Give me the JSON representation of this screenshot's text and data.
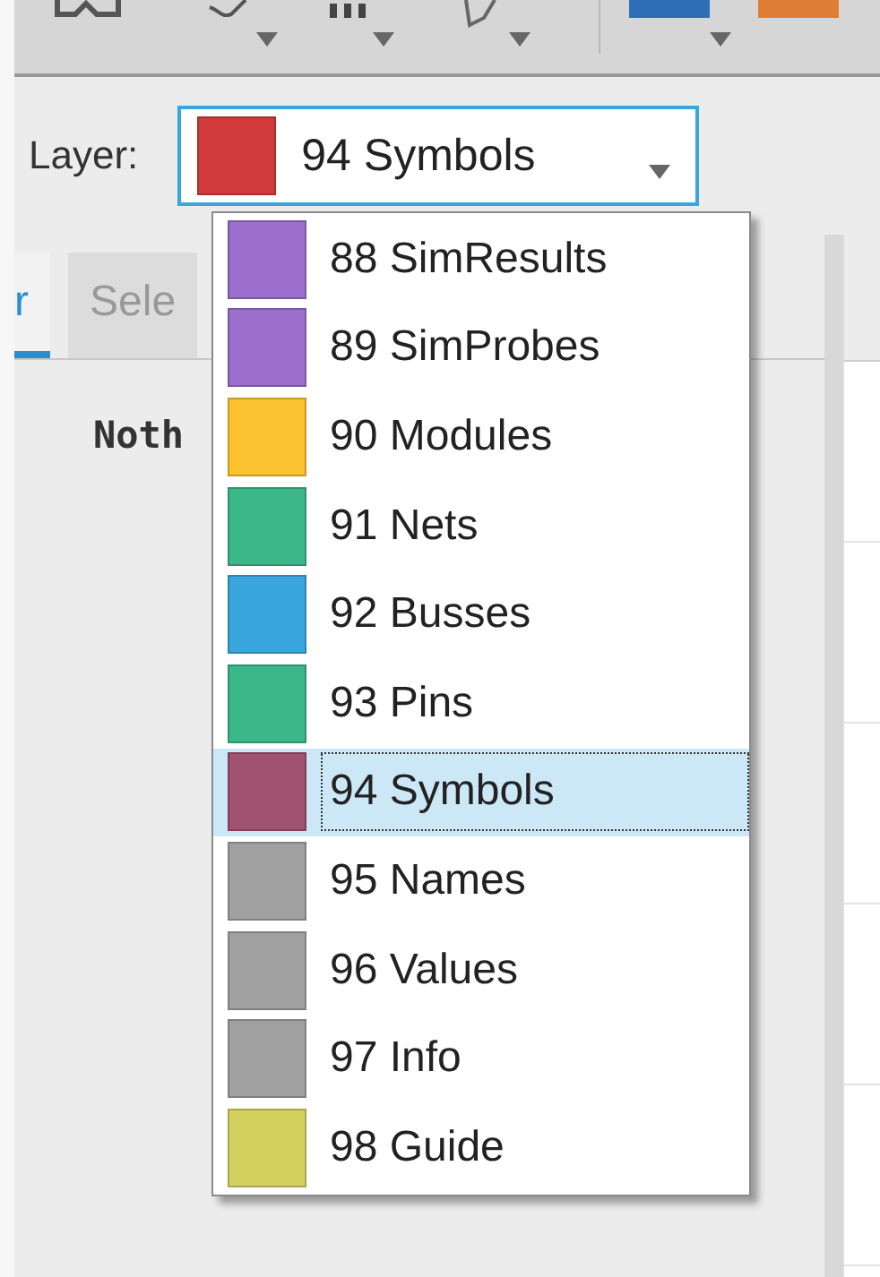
{
  "toolbar": {
    "swatches": [
      {
        "color": "#2d6fb7"
      },
      {
        "color": "#e07d35"
      }
    ]
  },
  "layer": {
    "label": "Layer:",
    "value": "94 Symbols",
    "color": "#d13b3b"
  },
  "layers": [
    {
      "name": "88 SimResults",
      "color": "#9b6fcb",
      "selected": false
    },
    {
      "name": "89 SimProbes",
      "color": "#9b6fcb",
      "selected": false
    },
    {
      "name": "90 Modules",
      "color": "#fbc12f",
      "selected": false
    },
    {
      "name": "91 Nets",
      "color": "#3bb78a",
      "selected": false
    },
    {
      "name": "92 Busses",
      "color": "#3aa6de",
      "selected": false
    },
    {
      "name": "93 Pins",
      "color": "#3bb78a",
      "selected": false
    },
    {
      "name": "94 Symbols",
      "color": "#a0526e",
      "selected": true
    },
    {
      "name": "95 Names",
      "color": "#a0a0a0",
      "selected": false
    },
    {
      "name": "96 Values",
      "color": "#a0a0a0",
      "selected": false
    },
    {
      "name": "97 Info",
      "color": "#a0a0a0",
      "selected": false
    },
    {
      "name": "98 Guide",
      "color": "#d4d160",
      "selected": false
    }
  ],
  "tabs": [
    {
      "label": "r",
      "selected": true
    },
    {
      "label": "Sele",
      "selected": false
    }
  ],
  "panel_text": "Noth"
}
